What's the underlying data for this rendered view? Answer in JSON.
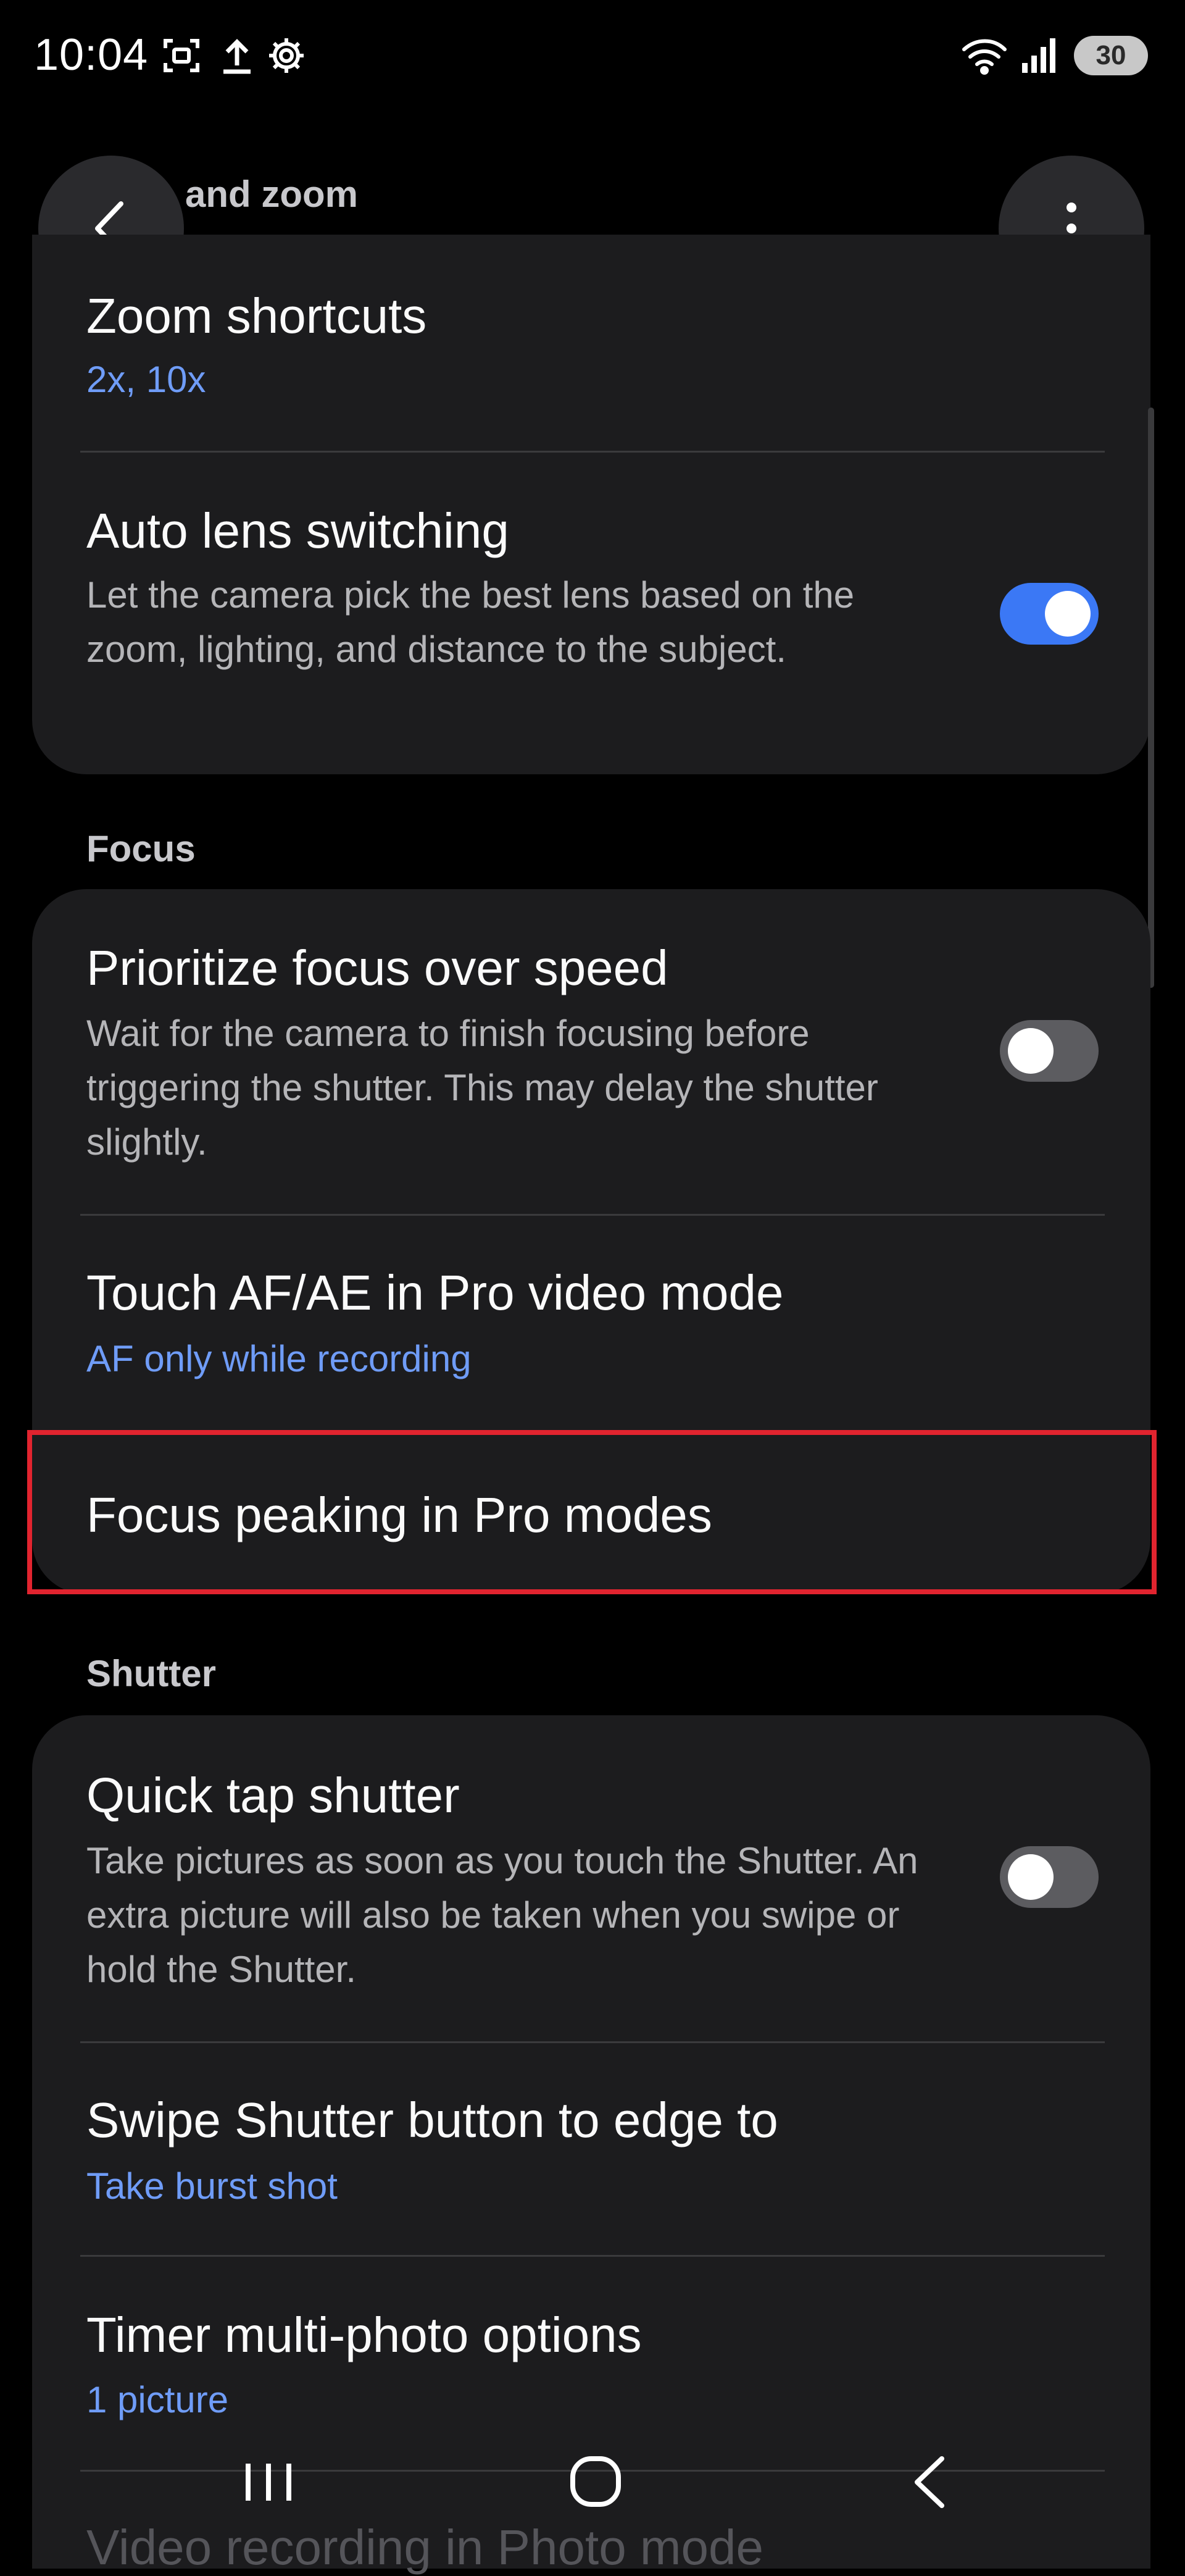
{
  "status_bar": {
    "time": "10:04",
    "battery": "30",
    "icons": [
      "screenshot-icon",
      "upload-icon",
      "settings-icon",
      "wifi-icon",
      "signal-icon"
    ]
  },
  "header": {
    "section_partial": "and zoom",
    "back_icon": "chevron-left-icon",
    "more_icon": "more-vertical-icon"
  },
  "lens_zoom": {
    "zoom_shortcuts": {
      "title": "Zoom shortcuts",
      "value": "2x, 10x"
    },
    "auto_lens": {
      "title": "Auto lens switching",
      "desc": "Let the camera pick the best lens based on the zoom, lighting, and distance to the subject.",
      "enabled": true
    }
  },
  "focus": {
    "section": "Focus",
    "prioritize": {
      "title": "Prioritize focus over speed",
      "desc": "Wait for the camera to finish focusing before triggering the shutter. This may delay the shutter slightly.",
      "enabled": false
    },
    "touch_af": {
      "title": "Touch AF/AE in Pro video mode",
      "value": "AF only while recording"
    },
    "peaking": {
      "title": "Focus peaking in Pro modes"
    }
  },
  "shutter": {
    "section": "Shutter",
    "quick_tap": {
      "title": "Quick tap shutter",
      "desc": "Take pictures as soon as you touch the Shutter. An extra picture will also be taken when you swipe or hold the Shutter.",
      "enabled": false
    },
    "swipe": {
      "title": "Swipe Shutter button to edge to",
      "value": "Take burst shot"
    },
    "timer": {
      "title": "Timer multi-photo options",
      "value": "1 picture"
    },
    "video_partial": {
      "title": "Video recording in Photo mode"
    }
  },
  "colors": {
    "accent_blue": "#6f9cf7",
    "toggle_on": "#3b78f5",
    "card_bg": "#1c1c1e",
    "highlight_red": "#e1242f"
  },
  "navbar": {
    "icons": [
      "recents-icon",
      "home-icon",
      "back-icon"
    ]
  }
}
